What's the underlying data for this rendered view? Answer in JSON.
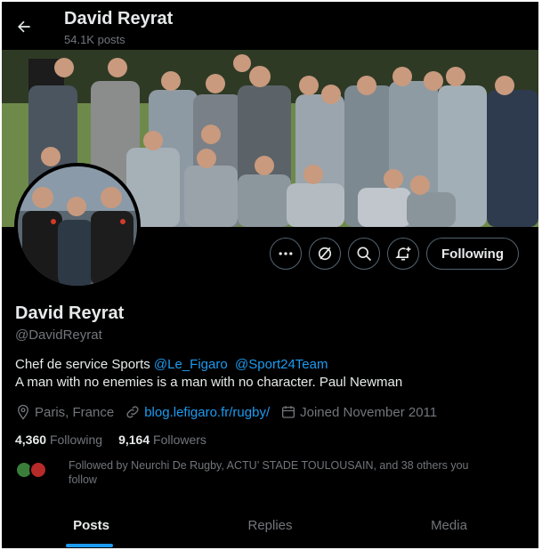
{
  "header": {
    "back_icon": "arrow-left-icon",
    "name": "David Reyrat",
    "posts_count": "54.1K posts"
  },
  "banner": {
    "description_icon": "team-photo"
  },
  "avatar": {
    "icon": "profile-photo"
  },
  "actions": {
    "more_icon": "more-dots-icon",
    "grok_icon": "slash-circle-icon",
    "search_icon": "search-icon",
    "notify_icon": "bell-plus-icon",
    "follow_label": "Following"
  },
  "profile": {
    "display_name": "David Reyrat",
    "handle": "@DavidReyrat",
    "bio_prefix": "Chef de service Sports ",
    "mention1": "@Le_Figaro",
    "mention2": "@Sport24Team",
    "bio_line2": "A man with no enemies is a man with no character. Paul Newman",
    "location": "Paris, France",
    "website": "blog.lefigaro.fr/rugby/",
    "joined": "Joined November 2011",
    "following_count": "4,360",
    "following_label": "Following",
    "followers_count": "9,164",
    "followers_label": "Followers",
    "followed_by": "Followed by Neurchi De Rugby, ACTU’ STADE TOULOUSAIN, and 38 others you follow"
  },
  "tabs": [
    {
      "label": "Posts"
    },
    {
      "label": "Replies"
    },
    {
      "label": "Media"
    }
  ],
  "colors": {
    "background": "#000000",
    "text": "#e7e9ea",
    "muted": "#71767b",
    "accent": "#1d9bf0",
    "border": "#536471"
  }
}
